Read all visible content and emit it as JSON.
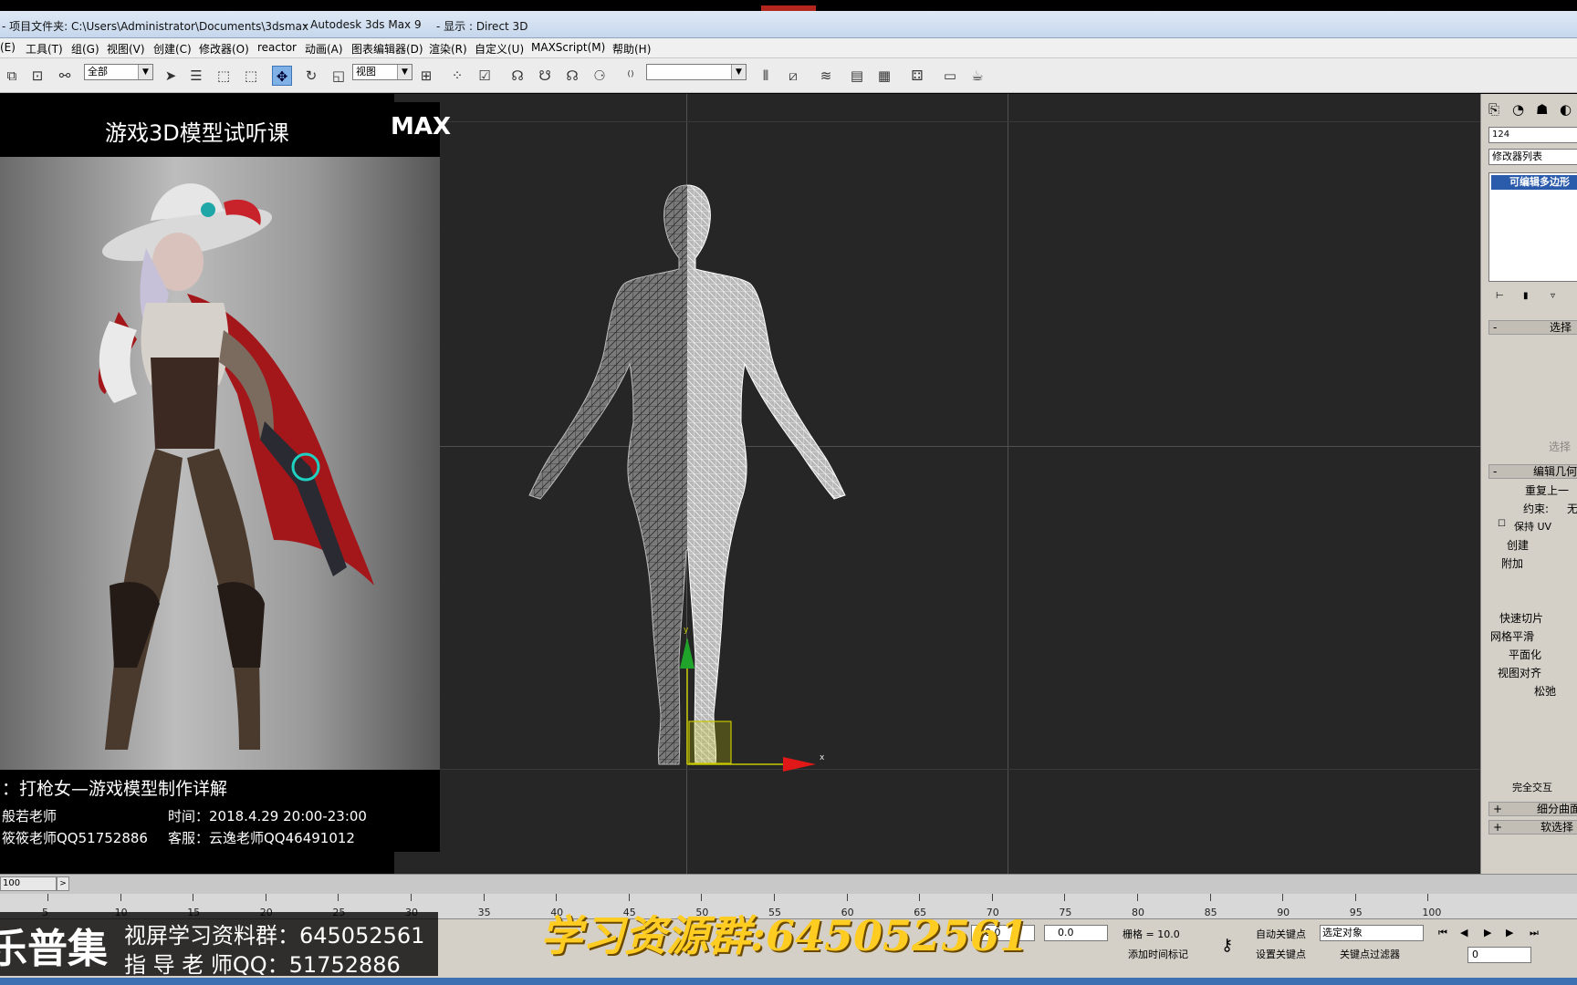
{
  "title_bar": {
    "project": "- 项目文件夹: C:\\Users\\Administrator\\Documents\\3dsmax",
    "app": "- Autodesk 3ds Max 9",
    "display": "- 显示 : Direct 3D"
  },
  "menu": [
    "(E)",
    "工具(T)",
    "组(G)",
    "视图(V)",
    "创建(C)",
    "修改器(O)",
    "reactor",
    "动画(A)",
    "图表编辑器(D)",
    "渲染(R)",
    "自定义(U)",
    "MAXScript(M)",
    "帮助(H)"
  ],
  "toolbar": {
    "selection_filter": "全部",
    "coord_system": "视图",
    "named_selection": ""
  },
  "reference_panel": {
    "title": "游戏3D模型试听课",
    "badge": "MAX",
    "course": "：打枪女—游戏模型制作详解",
    "teacher": "般若老师",
    "time": "时间：2018.4.29  20:00-23:00",
    "assistant": "筱筱老师QQ51752886",
    "service": "客服：云逸老师QQ46491012"
  },
  "command_panel": {
    "object_name": "124",
    "modifier_list": "修改器列表",
    "stack_item": "可编辑多边形",
    "rollout_select": "选择",
    "rollout_edit_geometry": "编辑几何",
    "repeat_last": "重复上一",
    "constraint": "约束:",
    "constraint_value": "无",
    "preserve_uv": "保持 UV",
    "create": "创建",
    "attach": "附加",
    "quickslice": "快速切片",
    "meshsmooth": "网格平滑",
    "planarize": "平面化",
    "view_align": "视图对齐",
    "relax": "松弛",
    "full_interactive": "完全交互",
    "subdivision_surface": "细分曲面",
    "soft_selection": "软选择",
    "select_label": "选择"
  },
  "timeline": {
    "frame_display": "100",
    "ticks": [
      5,
      10,
      15,
      20,
      25,
      30,
      35,
      40,
      45,
      50,
      55,
      60,
      65,
      70,
      75,
      80,
      85,
      90,
      95,
      100
    ]
  },
  "status": {
    "x_value": "0.0",
    "z_value": "0.0",
    "grid": "栅格 = 10.0",
    "add_time_tag": "添加时间标记",
    "auto_key": "自动关键点",
    "selected_object": "选定对象",
    "set_key": "设置关键点",
    "key_filters": "关键点过滤器",
    "frame_input": "0"
  },
  "overlays": {
    "brand": "乐普集",
    "group_line": "视屏学习资料群：645052561",
    "teacher_line": "指 导 老 师QQ：51752886",
    "center_banner": "学习资源群:645052561"
  },
  "colors": {
    "viewport_bg": "#262626",
    "gizmo_y": "#1fa32b",
    "gizmo_x": "#e01818",
    "banner": "#ffcc22",
    "active_tool": "#7fb0e6"
  },
  "icons": {
    "select": "cursor-icon",
    "move": "move-icon",
    "rotate": "rotate-icon",
    "scale": "scale-icon"
  }
}
